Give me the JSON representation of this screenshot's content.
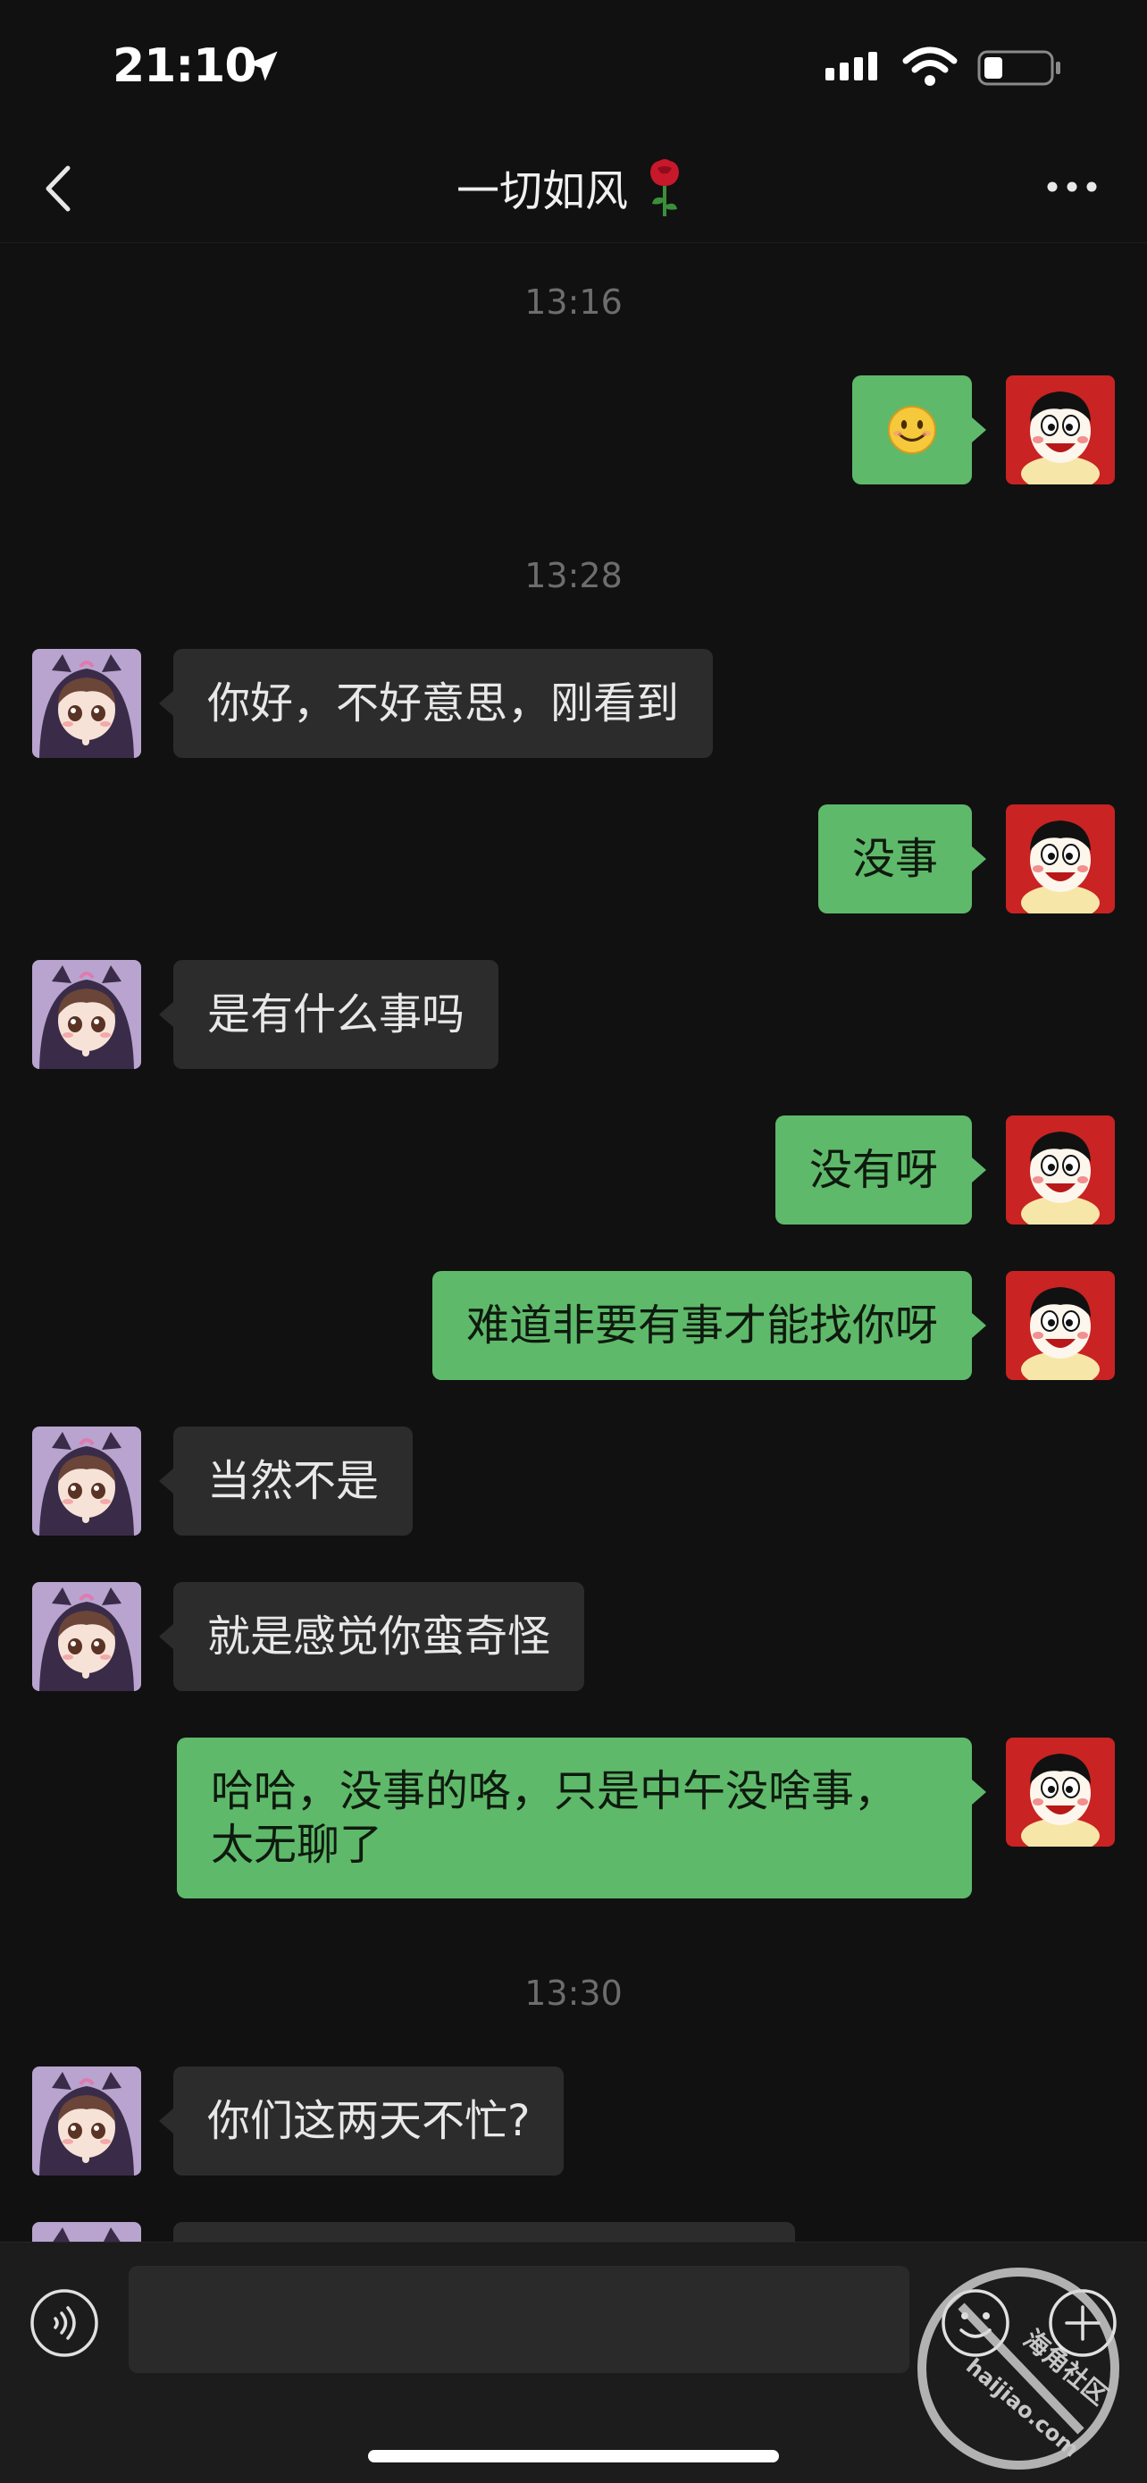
{
  "status_bar": {
    "time": "21:10"
  },
  "nav": {
    "title": "一切如风"
  },
  "messages": [
    {
      "type": "time",
      "text": "13:16"
    },
    {
      "type": "out",
      "text": "😊",
      "emoji": "smile-emoji"
    },
    {
      "type": "time",
      "text": "13:28"
    },
    {
      "type": "in",
      "text": "你好，不好意思，刚看到"
    },
    {
      "type": "out",
      "text": "没事"
    },
    {
      "type": "in",
      "text": "是有什么事吗"
    },
    {
      "type": "out",
      "text": "没有呀"
    },
    {
      "type": "out",
      "text": "难道非要有事才能找你呀"
    },
    {
      "type": "in",
      "text": "当然不是"
    },
    {
      "type": "in",
      "text": "就是感觉你蛮奇怪"
    },
    {
      "type": "out",
      "text": "哈哈，没事的咯，只是中午没啥事，太无聊了"
    },
    {
      "type": "time",
      "text": "13:30"
    },
    {
      "type": "in",
      "text": "你们这两天不忙?"
    }
  ],
  "input_bar": {
    "placeholder": ""
  },
  "watermark": {
    "line1": "海角社区",
    "line2": "haijiao.com"
  },
  "colors": {
    "background": "#111111",
    "incoming_bubble": "#2c2c2c",
    "outgoing_bubble": "#5fb96a",
    "timestamp": "#6d6d6d"
  }
}
